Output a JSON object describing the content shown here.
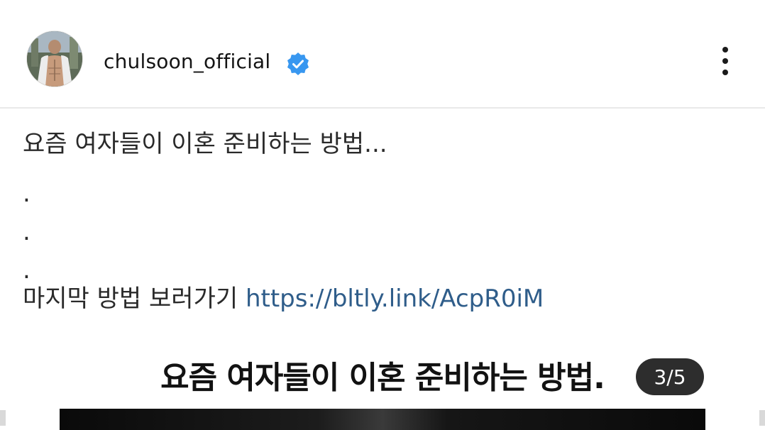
{
  "post_header": {
    "username": "chulsoon_official",
    "avatar_icon": "profile-photo",
    "verified_icon": "verified-badge-icon",
    "verified_color": "#3897f0",
    "more_icon": "more-vertical-icon"
  },
  "caption": {
    "title": "요즘 여자들이 이혼 준비하는 방법...",
    "dots": [
      ".",
      ".",
      "."
    ],
    "cta_text": "마지막 방법 보러가기",
    "link": "https://bltly.link/AcpR0iM",
    "link_color": "#2f5d8a"
  },
  "post_image": {
    "heading": "요즘 여자들이 이혼 준비하는 방법.",
    "counter": "3/5"
  }
}
